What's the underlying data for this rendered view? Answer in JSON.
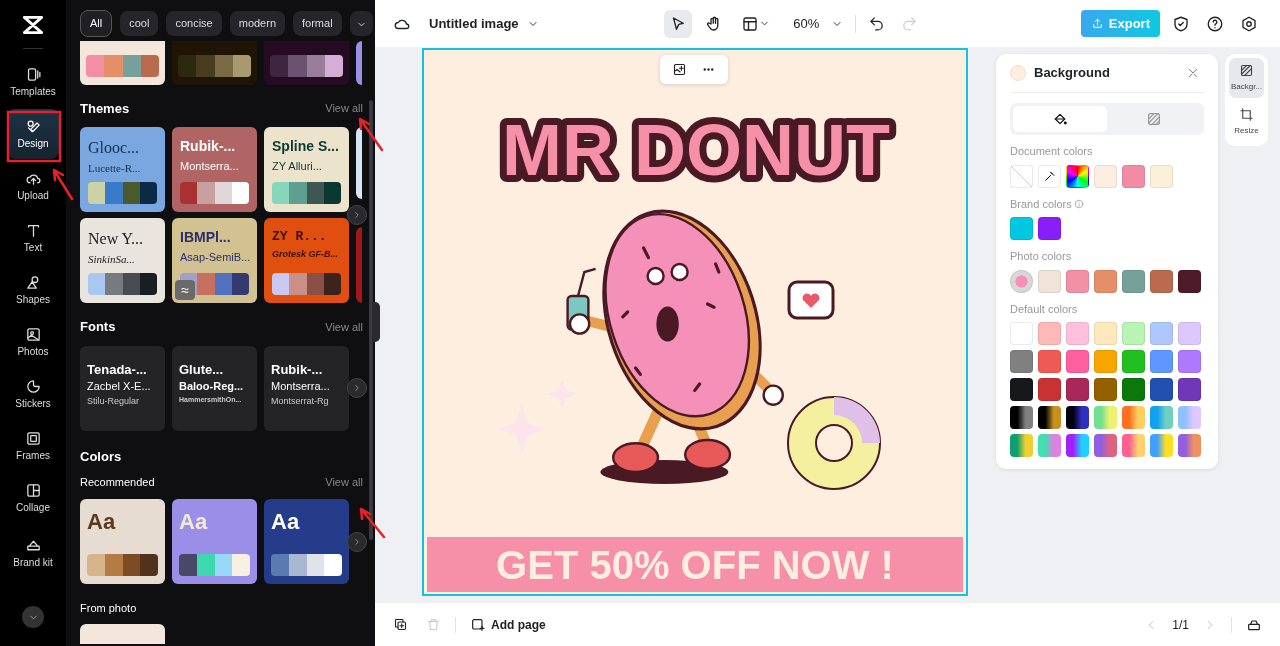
{
  "sidebar": {
    "items": [
      {
        "label": "Templates",
        "selected": false
      },
      {
        "label": "Design",
        "selected": true
      },
      {
        "label": "Upload",
        "selected": false
      },
      {
        "label": "Text",
        "selected": false
      },
      {
        "label": "Shapes",
        "selected": false
      },
      {
        "label": "Photos",
        "selected": false
      },
      {
        "label": "Stickers",
        "selected": false
      },
      {
        "label": "Frames",
        "selected": false
      },
      {
        "label": "Collage",
        "selected": false
      },
      {
        "label": "Brand kit",
        "selected": false
      }
    ]
  },
  "panel": {
    "filters": [
      {
        "label": "All",
        "selected": true
      },
      {
        "label": "cool",
        "selected": false
      },
      {
        "label": "concise",
        "selected": false
      },
      {
        "label": "modern",
        "selected": false
      },
      {
        "label": "formal",
        "selected": false
      }
    ],
    "top_palettes": [
      {
        "color": "#f3e6da",
        "swatches": [
          {
            "color": "#f28fa5"
          },
          {
            "color": "#e58f68"
          },
          {
            "color": "#76a19a"
          },
          {
            "color": "#b96a4f"
          }
        ]
      },
      {
        "color": "#201505",
        "swatches": [
          {
            "color": "#2d2810"
          },
          {
            "color": "#4a3c1f"
          },
          {
            "color": "#7a6a45"
          },
          {
            "color": "#a89a70"
          }
        ]
      },
      {
        "color": "#250c22",
        "swatches": [
          {
            "color": "#3e2640"
          },
          {
            "color": "#6b5270"
          },
          {
            "color": "#9a7d9a"
          },
          {
            "color": "#d3afd3"
          }
        ]
      }
    ],
    "themes": {
      "title": "Themes",
      "view_all": "View all",
      "cards": [
        {
          "title": "Glooc...",
          "subtitle": "Lucette-R...",
          "color": "#7ba7e0",
          "swatches": [
            {
              "color": "#cbd3a6"
            },
            {
              "color": "#3a7ac8"
            },
            {
              "color": "#4a5a2a"
            },
            {
              "color": "#0a2a45"
            }
          ]
        },
        {
          "title": "Rubik-...",
          "subtitle": "Montserra...",
          "color": "#b06464",
          "swatches": [
            {
              "color": "#a83232"
            },
            {
              "color": "#c8a0a0"
            },
            {
              "color": "#e0d8d8"
            },
            {
              "color": "#ffffff"
            }
          ]
        },
        {
          "title": "Spline S...",
          "subtitle": "ZY Alluri...",
          "color": "#ece3cc",
          "swatches": [
            {
              "color": "#86d6bc"
            },
            {
              "color": "#5f9f90"
            },
            {
              "color": "#3e5752"
            },
            {
              "color": "#0c3832"
            }
          ]
        },
        {
          "title": "New Y...",
          "subtitle": "SinkinSa...",
          "color": "#e8e4de",
          "swatches": [
            {
              "color": "#a8c8f0"
            },
            {
              "color": "#777b80"
            },
            {
              "color": "#474b52"
            },
            {
              "color": "#1a1d22"
            }
          ]
        },
        {
          "title": "IBMPl...",
          "subtitle": "Asap-SemiB...",
          "color": "#d3c291",
          "badge": "≈",
          "swatches": [
            {
              "color": "#a0a0c8"
            },
            {
              "color": "#c87060"
            },
            {
              "color": "#5272c0"
            },
            {
              "color": "#343a70"
            }
          ]
        },
        {
          "title": "ZY R...",
          "subtitle": "Grotesk GF-B...",
          "color": "#e04f10",
          "swatches": [
            {
              "color": "#c8c8f0"
            },
            {
              "color": "#c89088"
            },
            {
              "color": "#8a5048"
            },
            {
              "color": "#3a241c"
            }
          ]
        }
      ]
    },
    "fonts": {
      "title": "Fonts",
      "view_all": "View all",
      "cards": [
        {
          "lines": [
            "Tenada-...",
            "Zacbel X-E...",
            "Stilu-Regular"
          ]
        },
        {
          "lines": [
            "Glute...",
            "Baloo-Reg...",
            "HammersmithOn..."
          ]
        },
        {
          "lines": [
            "Rubik-...",
            "Montserra...",
            "Montserrat-Rg"
          ]
        }
      ]
    },
    "colors": {
      "title": "Colors",
      "subtitle": "Recommended",
      "view_all": "View all",
      "cards": [
        {
          "sample": {
            "text": "Aa",
            "color": "#5a3a1e"
          },
          "color": "#e6dcd2",
          "swatches": [
            {
              "color": "#d8b48a"
            },
            {
              "color": "#b47c44"
            },
            {
              "color": "#7c4c24"
            },
            {
              "color": "#52321c"
            }
          ]
        },
        {
          "sample": {
            "text": "Aa",
            "color": "#f0ead8"
          },
          "color": "#9a8ee8",
          "swatches": [
            {
              "color": "#4a4868"
            },
            {
              "color": "#3ed8b0"
            },
            {
              "color": "#98d8f8"
            },
            {
              "color": "#f5f0e0"
            }
          ]
        },
        {
          "sample": {
            "text": "Aa",
            "color": "#ffffff"
          },
          "color": "#243c8a",
          "swatches": [
            {
              "color": "#5a7ab0"
            },
            {
              "color": "#a8b8d0"
            },
            {
              "color": "#e0e4ea"
            },
            {
              "color": "#ffffff"
            }
          ]
        }
      ]
    },
    "from_photo": "From photo"
  },
  "topbar": {
    "title": "Untitled image",
    "tools": [
      {
        "selected": true
      },
      {
        "selected": false
      },
      {
        "selected": false
      }
    ],
    "zoom": "60%",
    "redo_disabled": true,
    "export": "Export"
  },
  "canvas": {
    "headline": "MR DONUT",
    "banner": "GET 50% OFF NOW !",
    "color": "#fdeee0"
  },
  "background_panel": {
    "title": "Background",
    "color": "#fdeee0",
    "tabs": [
      {
        "selected": true
      },
      {
        "selected": false
      }
    ],
    "sections": [
      {
        "title": "Document colors",
        "swatches": [
          {
            "kind": "none"
          },
          {
            "kind": "picker"
          },
          {
            "kind": "spectrum"
          },
          {
            "color": "#fdeee2"
          },
          {
            "color": "#f28ca5"
          },
          {
            "color": "#fdf0d8"
          }
        ]
      },
      {
        "title": "Brand colors",
        "info": true,
        "swatches": [
          {
            "color": "#00c8e0"
          },
          {
            "color": "#8a1ef8"
          }
        ]
      },
      {
        "title": "Photo colors",
        "swatches": [
          {
            "kind": "photo"
          },
          {
            "color": "#f0e4d8"
          },
          {
            "color": "#f290a5"
          },
          {
            "color": "#e58f68"
          },
          {
            "color": "#76a19a"
          },
          {
            "color": "#b96a4f"
          },
          {
            "color": "#4e1c28"
          }
        ]
      },
      {
        "title": "Default colors",
        "swatches": [
          {
            "color": "#ffffff"
          },
          {
            "color": "#ffb8b8"
          },
          {
            "color": "#ffc0dc"
          },
          {
            "color": "#ffe9bc"
          },
          {
            "color": "#b8f4b4"
          },
          {
            "color": "#aec8ff"
          },
          {
            "color": "#dcc8ff"
          },
          {
            "color": "#808080"
          },
          {
            "color": "#f05a55"
          },
          {
            "color": "#ff5f9e"
          },
          {
            "color": "#f8a500"
          },
          {
            "color": "#20c020"
          },
          {
            "color": "#6096ff"
          },
          {
            "color": "#ae78ff"
          },
          {
            "color": "#16181c"
          },
          {
            "color": "#c83232"
          },
          {
            "color": "#a8285a"
          },
          {
            "color": "#946000"
          },
          {
            "color": "#0a780a"
          },
          {
            "color": "#2050b0"
          },
          {
            "color": "#7038b8"
          },
          {
            "gradient": [
              {
                "color": "#000000"
              },
              {
                "color": "#808080"
              }
            ]
          },
          {
            "gradient": [
              {
                "color": "#000000"
              },
              {
                "color": "#c89020"
              }
            ]
          },
          {
            "gradient": [
              {
                "color": "#000010"
              },
              {
                "color": "#3030c0"
              }
            ]
          },
          {
            "gradient": [
              {
                "color": "#70e090"
              },
              {
                "color": "#f0f070"
              }
            ]
          },
          {
            "gradient": [
              {
                "color": "#ff7020"
              },
              {
                "color": "#ffd060"
              }
            ]
          },
          {
            "gradient": [
              {
                "color": "#10a0f0"
              },
              {
                "color": "#70d0c0"
              }
            ]
          },
          {
            "gradient": [
              {
                "color": "#90c0ff"
              },
              {
                "color": "#e0c8ff"
              }
            ]
          },
          {
            "gradient": [
              {
                "color": "#10a070"
              },
              {
                "color": "#f0d030"
              }
            ]
          },
          {
            "gradient": [
              {
                "color": "#40e0b0"
              },
              {
                "color": "#e080e0"
              }
            ]
          },
          {
            "gradient": [
              {
                "color": "#a020ff"
              },
              {
                "color": "#20d0ff"
              }
            ]
          },
          {
            "gradient": [
              {
                "color": "#9060e0"
              },
              {
                "color": "#e06080"
              }
            ]
          },
          {
            "gradient": [
              {
                "color": "#ff6090"
              },
              {
                "color": "#ffd070"
              }
            ]
          },
          {
            "gradient": [
              {
                "color": "#40a0ff"
              },
              {
                "color": "#ffe020"
              }
            ]
          },
          {
            "gradient": [
              {
                "color": "#9060e0"
              },
              {
                "color": "#f09060"
              }
            ]
          }
        ]
      }
    ]
  },
  "side_tools": [
    {
      "label": "Backgr...",
      "selected": true
    },
    {
      "label": "Resize",
      "selected": false
    }
  ],
  "bottombar": {
    "add_page": "Add page",
    "page": "1/1",
    "delete_disabled": true,
    "prev_disabled": true,
    "next_disabled": true
  }
}
